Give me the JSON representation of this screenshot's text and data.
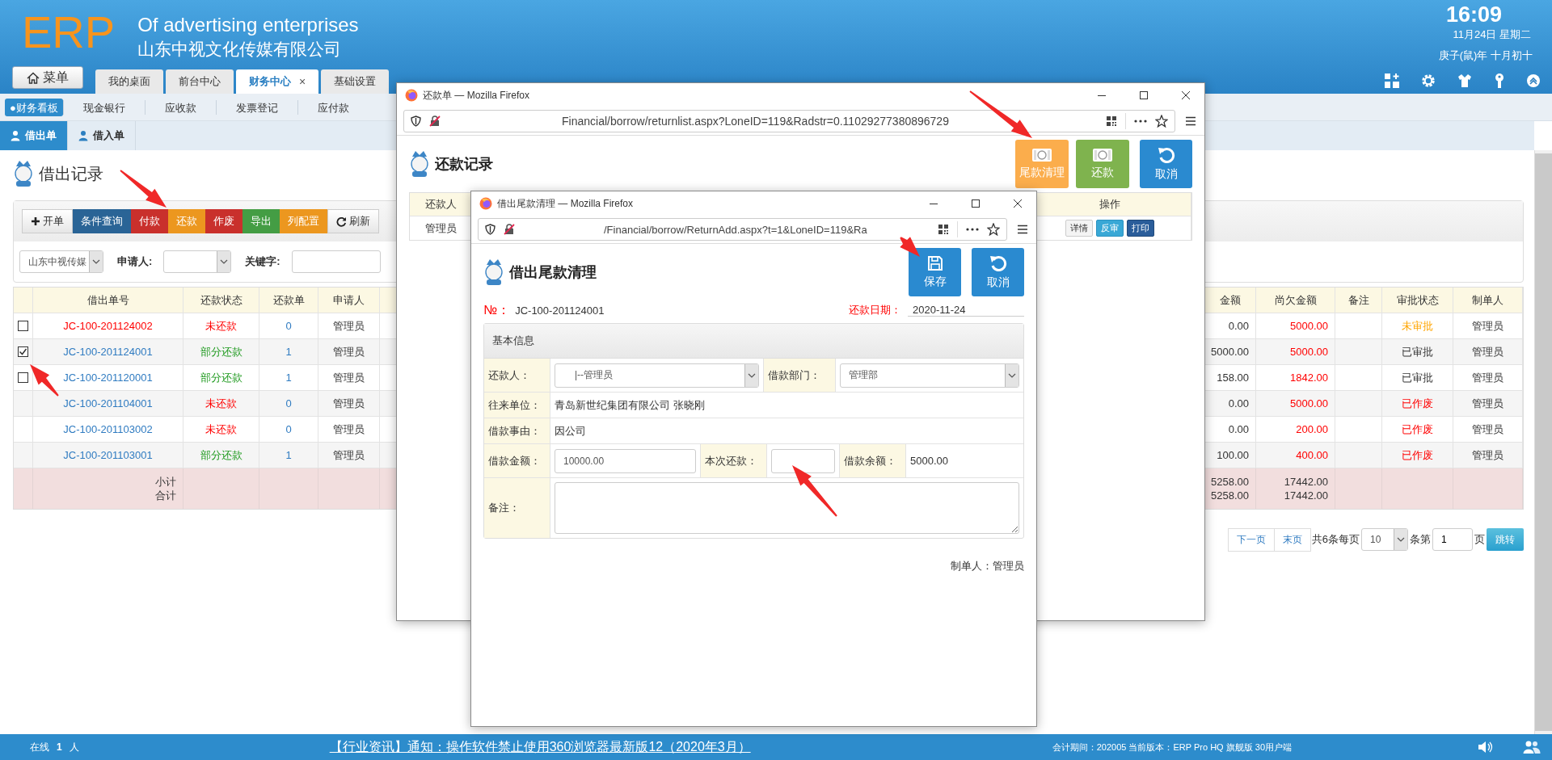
{
  "header": {
    "logo": "ERP",
    "company_en": "Of advertising enterprises",
    "company_cn": "山东中视文化传媒有限公司",
    "time": "16:09",
    "date": "11月24日 星期二",
    "lunar": "庚子(鼠)年 十月初十"
  },
  "menu_button": "菜单",
  "main_tabs": [
    {
      "label": "我的桌面",
      "selected": false
    },
    {
      "label": "前台中心",
      "selected": false
    },
    {
      "label": "财务中心",
      "selected": true,
      "close_label": "×"
    },
    {
      "label": "基础设置",
      "selected": false
    }
  ],
  "sub_nav": [
    {
      "label": "●财务看板",
      "selected": true
    },
    {
      "label": "现金银行",
      "selected": false
    },
    {
      "label": "应收款",
      "selected": false
    },
    {
      "label": "发票登记",
      "selected": false
    },
    {
      "label": "应付款",
      "selected": false
    }
  ],
  "doc_tabs": [
    {
      "label": "借出单",
      "selected": true
    },
    {
      "label": "借入单",
      "selected": false
    }
  ],
  "page_title": "借出记录",
  "toolbar": [
    {
      "label": "开单",
      "kind": "plus"
    },
    {
      "label": "条件查询",
      "kind": "primary"
    },
    {
      "label": "付款",
      "kind": "danger"
    },
    {
      "label": "还款",
      "kind": "warning"
    },
    {
      "label": "作废",
      "kind": "danger"
    },
    {
      "label": "导出",
      "kind": "success"
    },
    {
      "label": "列配置",
      "kind": "warning"
    },
    {
      "label": "刷新",
      "kind": "refresh"
    }
  ],
  "filters": {
    "company": "山东中视传媒",
    "applicant_label": "申请人:",
    "keyword_label": "关键字:"
  },
  "table": {
    "columns_left": [
      "借出单号",
      "还款状态",
      "还款单",
      "申请人"
    ],
    "columns_right": [
      "金额",
      "尚欠金额",
      "备注",
      "审批状态",
      "制单人"
    ],
    "rows": [
      {
        "checkbox": {
          "checked": false
        },
        "number": {
          "text": "JC-100-201124002",
          "kind": "alert"
        },
        "status": {
          "text": "未还款",
          "kind": "unpaid"
        },
        "returns": "0",
        "applicant": "管理员",
        "returned": "0.00",
        "owed": "5000.00",
        "approval": {
          "text": "未审批",
          "kind": "pending"
        },
        "maker": "管理员"
      },
      {
        "checkbox": {
          "checked": true
        },
        "number": {
          "text": "JC-100-201124001",
          "kind": "normal"
        },
        "status": {
          "text": "部分还款",
          "kind": "partial"
        },
        "returns": "1",
        "applicant": "管理员",
        "returned": "5000.00",
        "owed": "5000.00",
        "approval": {
          "text": "已审批",
          "kind": "approved"
        },
        "maker": "管理员"
      },
      {
        "checkbox": {
          "checked": false
        },
        "number": {
          "text": "JC-100-201120001",
          "kind": "normal"
        },
        "status": {
          "text": "部分还款",
          "kind": "partial"
        },
        "returns": "1",
        "applicant": "管理员",
        "returned": "158.00",
        "owed": "1842.00",
        "approval": {
          "text": "已审批",
          "kind": "approved"
        },
        "maker": "管理员"
      },
      {
        "number": {
          "text": "JC-100-201104001",
          "kind": "normal"
        },
        "status": {
          "text": "未还款",
          "kind": "unpaid"
        },
        "returns": "0",
        "applicant": "管理员",
        "returned": "0.00",
        "owed": "5000.00",
        "approval": {
          "text": "已作废",
          "kind": "void"
        },
        "maker": "管理员"
      },
      {
        "number": {
          "text": "JC-100-201103002",
          "kind": "normal"
        },
        "status": {
          "text": "未还款",
          "kind": "unpaid"
        },
        "returns": "0",
        "applicant": "管理员",
        "returned": "0.00",
        "owed": "200.00",
        "approval": {
          "text": "已作废",
          "kind": "void"
        },
        "maker": "管理员"
      },
      {
        "number": {
          "text": "JC-100-201103001",
          "kind": "normal"
        },
        "status": {
          "text": "部分还款",
          "kind": "partial"
        },
        "returns": "1",
        "applicant": "管理员",
        "returned": "100.00",
        "owed": "400.00",
        "approval": {
          "text": "已作废",
          "kind": "void"
        },
        "maker": "管理员"
      }
    ],
    "totals": [
      {
        "label": "小计",
        "returned": "5258.00",
        "owed": "17442.00"
      },
      {
        "label": "合计",
        "returned": "5258.00",
        "owed": "17442.00"
      }
    ]
  },
  "pagination": {
    "next": "下一页",
    "last": "末页",
    "summary": "共6条每页",
    "page_size": "10",
    "per_label": "条第",
    "page": "1",
    "page_suffix": "页",
    "go": "跳转"
  },
  "return_window": {
    "title": "还款单 — Mozilla Firefox",
    "url": "Financial/borrow/returnlist.aspx?LoneID=119&Radstr=0.11029277380896729",
    "heading": "还款记录",
    "buttons": [
      {
        "label": "尾款清理",
        "kind": "warning"
      },
      {
        "label": "还款",
        "kind": "success"
      },
      {
        "label": "取消",
        "kind": "primary"
      }
    ],
    "columns": [
      "还款人",
      "操作"
    ],
    "rows": [
      {
        "payer": "管理员",
        "actions": [
          {
            "label": "详情",
            "kind": "default"
          },
          {
            "label": "反审",
            "kind": "info"
          },
          {
            "label": "打印",
            "kind": "primary"
          }
        ]
      }
    ]
  },
  "clearance_window": {
    "title": "借出尾款清理 — Mozilla Firefox",
    "url": "/Financial/borrow/ReturnAdd.aspx?t=1&LoneID=119&Ra",
    "heading": "借出尾款清理",
    "buttons": [
      {
        "label": "保存",
        "kind": "save"
      },
      {
        "label": "取消",
        "kind": "cancel"
      }
    ],
    "no_label": "№：",
    "no_value": "JC-100-201124001",
    "date_label": "还款日期：",
    "date_value": "2020-11-24",
    "section": "基本信息",
    "payer_label": "还款人：",
    "payer_value": "|--管理员",
    "dept_label": "借款部门：",
    "dept_value": "管理部",
    "partner_label": "往来单位：",
    "partner_value": "青岛新世纪集团有限公司 张晓刚",
    "reason_label": "借款事由：",
    "reason_value": "因公司",
    "amount_label": "借款金额：",
    "amount_value": "10000.00",
    "repay_label": "本次还款：",
    "balance_label": "借款余额：",
    "balance_value": "5000.00",
    "note_label": "备注：",
    "maker": "制单人：管理员"
  },
  "status_bar": {
    "online_label": "在线",
    "online_count": "1",
    "online_unit": "人",
    "news": "【行业资讯】通知：操作软件禁止使用360浏览器最新版12（2020年3月）",
    "info": "会计期间：202005 当前版本：ERP Pro HQ 旗舰版 30用户端"
  }
}
